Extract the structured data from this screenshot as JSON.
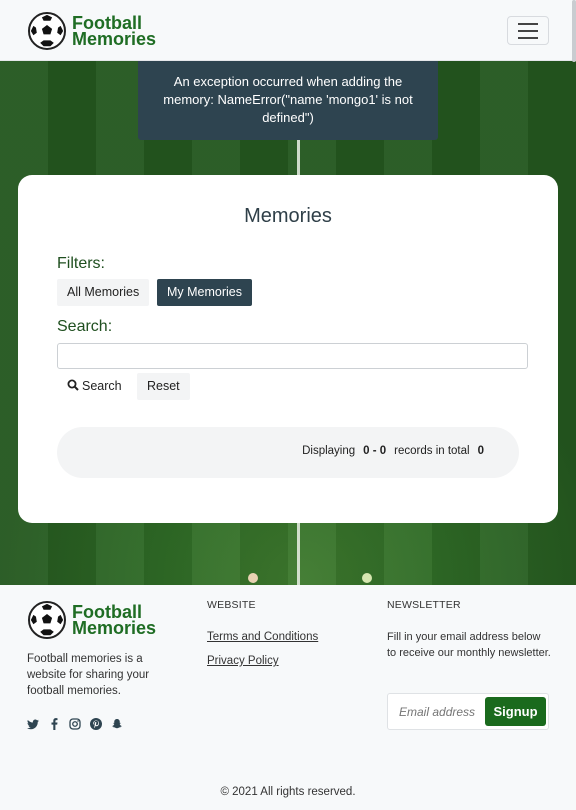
{
  "header": {
    "brand_line1": "Football",
    "brand_line2": "Memories",
    "logo_icon": "football-icon",
    "menu_icon": "hamburger-icon"
  },
  "alert": {
    "message": "An exception occurred when adding the memory: NameError(\"name 'mongo1' is not defined\")"
  },
  "card": {
    "title": "Memories",
    "filters_label": "Filters:",
    "filters": [
      "All Memories",
      "My Memories"
    ],
    "active_filter": "My Memories",
    "search_label": "Search:",
    "search_value": "",
    "search_button": "Search",
    "reset_button": "Reset",
    "pagination": {
      "prefix": "Displaying",
      "range": "0 - 0",
      "middle": "records in total",
      "total": "0"
    }
  },
  "footer": {
    "brand_line1": "Football",
    "brand_line2": "Memories",
    "about": "Football memories is a website for sharing your football memories.",
    "socials": [
      "twitter-icon",
      "facebook-icon",
      "instagram-icon",
      "pinterest-icon",
      "snapchat-icon"
    ],
    "website_heading": "WEBSITE",
    "links": [
      "Terms and Conditions",
      "Privacy Policy"
    ],
    "newsletter_heading": "NEWSLETTER",
    "newsletter_text": "Fill in your email address below to receive our monthly newsletter.",
    "email_placeholder": "Email address",
    "signup_button": "Signup",
    "copyright": "© 2021 All rights reserved."
  },
  "colors": {
    "brand_green": "#1f6d24",
    "dark_slate": "#2e4450",
    "signup_green": "#1a6a1d"
  }
}
